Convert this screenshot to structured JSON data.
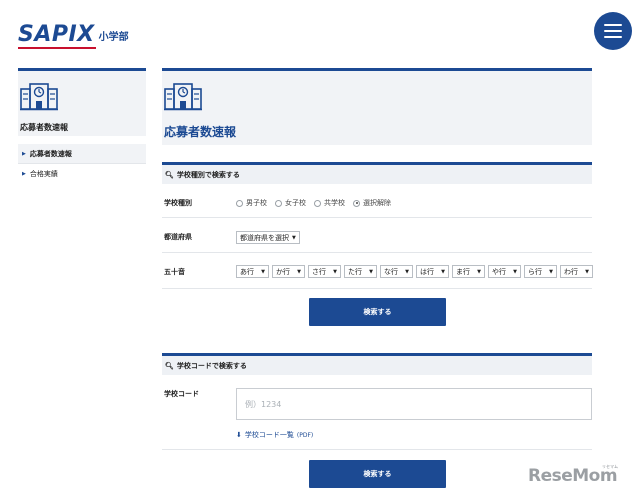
{
  "header": {
    "logo_main": "SAPIX",
    "logo_sub": "小学部"
  },
  "sidebar": {
    "title": "応募者数速報",
    "items": [
      {
        "label": "応募者数速報",
        "active": true
      },
      {
        "label": "合格実績",
        "active": false
      }
    ]
  },
  "main": {
    "title": "応募者数速報"
  },
  "search_by_type": {
    "heading": "学校種別で検索する",
    "school_type": {
      "label": "学校種別",
      "options": [
        "男子校",
        "女子校",
        "共学校",
        "選択解除"
      ],
      "selected": "選択解除"
    },
    "prefecture": {
      "label": "都道府県",
      "value": "都道府県を選択"
    },
    "gojuon": {
      "label": "五十音",
      "options": [
        "あ行",
        "か行",
        "さ行",
        "た行",
        "な行",
        "は行",
        "ま行",
        "や行",
        "ら行",
        "わ行"
      ]
    },
    "button": "検索する"
  },
  "search_by_code": {
    "heading": "学校コードで検索する",
    "code_label": "学校コード",
    "placeholder": "例）1234",
    "pdf_link": "学校コード一覧",
    "pdf_tag": "(PDF)",
    "button": "検索する"
  },
  "watermark": {
    "text": "ReseMom",
    "sub": "リセマム"
  },
  "colors": {
    "brand": "#1c4a93",
    "accent": "#c8102e",
    "panel": "#f1f3f6"
  }
}
